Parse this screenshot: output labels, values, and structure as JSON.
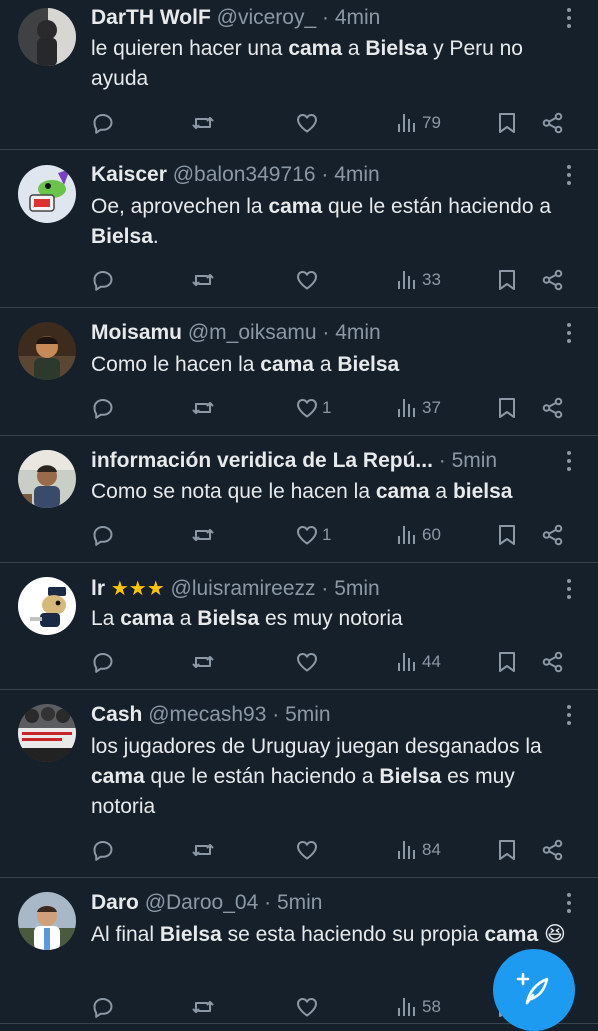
{
  "tweets": [
    {
      "name": "DarTH WolF",
      "handle": "@viceroy_",
      "time": "4min",
      "text": [
        {
          "t": "le quieren hacer una "
        },
        {
          "t": "cama",
          "b": true
        },
        {
          "t": " a "
        },
        {
          "t": "Bielsa",
          "b": true
        },
        {
          "t": " y Peru no ayuda"
        }
      ],
      "likes": "",
      "views": "79",
      "avatar": "dark-portrait"
    },
    {
      "name": "Kaiscer",
      "handle": "@balon349716",
      "time": "4min",
      "text": [
        {
          "t": "Oe, aprovechen la "
        },
        {
          "t": "cama",
          "b": true
        },
        {
          "t": " que le están haciendo a "
        },
        {
          "t": "Bielsa",
          "b": true
        },
        {
          "t": "."
        }
      ],
      "likes": "",
      "views": "33",
      "avatar": "cartoon-frog"
    },
    {
      "name": "Moisamu",
      "handle": "@m_oiksamu",
      "time": "4min",
      "text": [
        {
          "t": "Como le hacen la "
        },
        {
          "t": "cama",
          "b": true
        },
        {
          "t": " a "
        },
        {
          "t": "Bielsa",
          "b": true
        }
      ],
      "likes": "1",
      "views": "37",
      "avatar": "warm-portrait"
    },
    {
      "name": "información veridica de La Repú...",
      "handle": "",
      "time": "5min",
      "text": [
        {
          "t": "Como se nota que le hacen la "
        },
        {
          "t": "cama",
          "b": true
        },
        {
          "t": " a "
        },
        {
          "t": "bielsa",
          "b": true
        }
      ],
      "likes": "1",
      "views": "60",
      "avatar": "outdoor-portrait"
    },
    {
      "name": "lr",
      "stars": "★★★",
      "handle": "@luisramireezz",
      "time": "5min",
      "text": [
        {
          "t": "La "
        },
        {
          "t": "cama",
          "b": true
        },
        {
          "t": " a "
        },
        {
          "t": "Bielsa",
          "b": true
        },
        {
          "t": " es muy notoria"
        }
      ],
      "likes": "",
      "views": "44",
      "avatar": "cartoon-character"
    },
    {
      "name": "Cash",
      "handle": "@mecash93",
      "time": "5min",
      "text": [
        {
          "t": "los jugadores de Uruguay juegan desganados la "
        },
        {
          "t": "cama",
          "b": true
        },
        {
          "t": " que le están haciendo a "
        },
        {
          "t": "Bielsa",
          "b": true
        },
        {
          "t": " es muy notoria"
        }
      ],
      "likes": "",
      "views": "84",
      "avatar": "crowd-banner"
    },
    {
      "name": "Daro",
      "handle": "@Daroo_04",
      "time": "5min",
      "text": [
        {
          "t": "Al final "
        },
        {
          "t": "Bielsa",
          "b": true
        },
        {
          "t": " se esta haciendo su propia "
        },
        {
          "t": "cama",
          "b": true
        },
        {
          "t": " 😆"
        }
      ],
      "likes": "",
      "views": "58",
      "avatar": "person-outdoors"
    }
  ],
  "icons": {
    "reply": "reply-icon",
    "retweet": "retweet-icon",
    "like": "heart-icon",
    "views": "views-icon",
    "bookmark": "bookmark-icon",
    "share": "share-icon",
    "more": "more-icon",
    "compose": "compose-icon"
  },
  "colors": {
    "background": "#15202b",
    "text": "#e7e9ea",
    "muted": "#8b98a5",
    "divider": "#38444d",
    "accent": "#1d9bf0",
    "star": "#ffc400"
  }
}
